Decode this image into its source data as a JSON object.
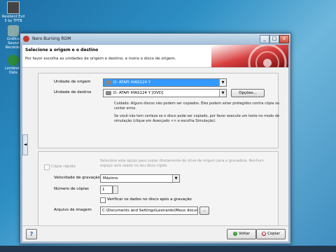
{
  "desktop": {
    "icons": [
      {
        "label": "Resident Evil 5 by TPTB"
      },
      {
        "label": "Gráfico Sound Recorder"
      },
      {
        "label": "Lembrete Data"
      }
    ]
  },
  "window": {
    "title": "Nero Burning ROM",
    "controls": {
      "minimize": "_",
      "maximize": "□",
      "close": "x"
    }
  },
  "header": {
    "title": "Selecione a origem e o destino",
    "subtitle": "Por favor escolha as unidades de origem e destino, e insira o disco de origem."
  },
  "source": {
    "label": "Unidade de origem",
    "value": "D: ATAPI iHAS124   Y",
    "arrow": "▼"
  },
  "destination": {
    "label": "Unidade de destino",
    "value": "D: ATAPI iHAS124   Y  [DVD]",
    "arrow": "▼",
    "options_button": "Opções..."
  },
  "notes": {
    "line1": "Cuidado: Alguns discos não podem ser copiados. Eles podem estar protegidos contra cópia ou conter erros.",
    "line2": "Se você não tem certeza se o disco pode ser copiado, por favor execute um teste no modo de simulação (clique em Avançado << e escolha Simulação)."
  },
  "settings": {
    "quick_copy_label": "Cópia rápida",
    "quick_copy_note": "Selecione esta opção para copiar diretamente do drive de origem para o gravadora. Nenhum espaço será usado no seu disco rígido.",
    "speed_label": "Velocidade de gravação",
    "speed_value": "Máximo",
    "speed_arrow": "▼",
    "copies_label": "Número de cópias",
    "copies_value": "1",
    "verify_label": "Verificar os dados no disco após a gravação",
    "image_label": "Arquivo de imagem",
    "image_value": "C:\\Documents and Settings\\Leonardo\\Meus docum",
    "browse_label": "..."
  },
  "footer": {
    "help_label": "?",
    "back_label": "Voltar",
    "copy_label": "Copiar"
  },
  "side_arrow": "◄"
}
